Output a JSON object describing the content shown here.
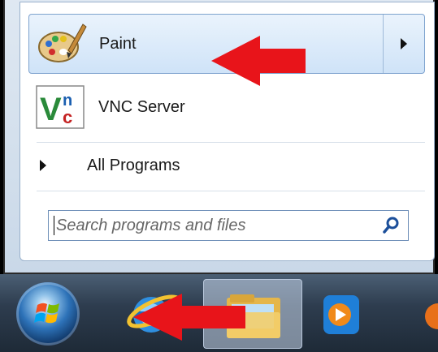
{
  "start_menu": {
    "pinned": [
      {
        "label": "Paint",
        "icon": "paint-palette-icon"
      },
      {
        "label": "VNC Server",
        "icon": "vnc-server-icon"
      }
    ],
    "all_programs": "All Programs",
    "search": {
      "placeholder": "Search programs and files",
      "icon": "search-icon"
    }
  },
  "taskbar": {
    "items": [
      {
        "icon": "windows-start-orb-icon"
      },
      {
        "icon": "internet-explorer-icon"
      },
      {
        "icon": "windows-explorer-folder-icon"
      },
      {
        "icon": "media-player-icon"
      }
    ]
  },
  "annotations": {
    "arrow_color": "#e8141a"
  }
}
